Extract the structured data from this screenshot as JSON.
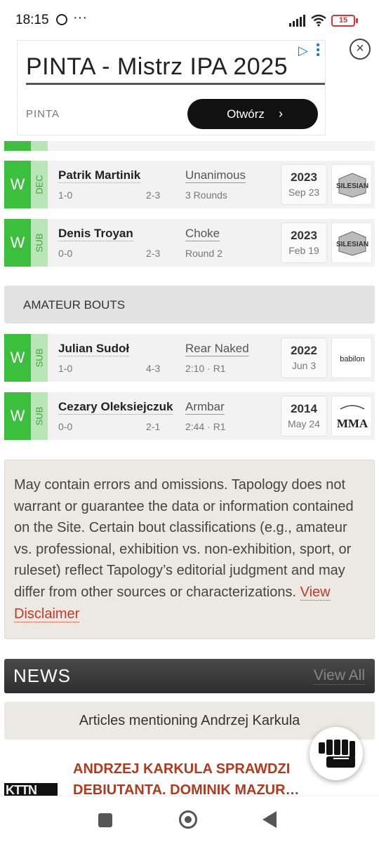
{
  "status_bar": {
    "time": "18:15",
    "dots": "···",
    "battery": "15"
  },
  "ad": {
    "title": "PINTA - Mistrz IPA 2025",
    "brand": "PINTA",
    "cta": "Otwórz",
    "close_icon": "close-icon"
  },
  "pro_bouts": [
    {
      "result": "W",
      "method": "DEC",
      "opponent": "Patrik Martinik",
      "opponent_record_before": "1-0",
      "opponent_record_after": "2-3",
      "detail": "Unanimous",
      "detail2": "3 Rounds",
      "year": "2023",
      "date": "Sep 23",
      "logo": "SILESIAN"
    },
    {
      "result": "W",
      "method": "SUB",
      "opponent": "Denis Troyan",
      "opponent_record_before": "0-0",
      "opponent_record_after": "2-3",
      "detail": "Choke",
      "detail2": "Round 2",
      "year": "2023",
      "date": "Feb 19",
      "logo": "SILESIAN"
    }
  ],
  "amateur_header": "AMATEUR BOUTS",
  "amateur_bouts": [
    {
      "result": "W",
      "method": "SUB",
      "opponent": "Julian Sudoł",
      "opponent_record_before": "1-0",
      "opponent_record_after": "4-3",
      "detail": "Rear Naked",
      "detail2": "2:10 · R1",
      "year": "2022",
      "date": "Jun 3",
      "logo": "babilon"
    },
    {
      "result": "W",
      "method": "SUB",
      "opponent": "Cezary Oleksiejczuk",
      "opponent_record_before": "0-0",
      "opponent_record_after": "2-1",
      "detail": "Armbar",
      "detail2": "2:44 · R1",
      "year": "2014",
      "date": "May 24",
      "logo": "MMA"
    }
  ],
  "disclaimer": {
    "text": "May contain errors and omissions. Tapology does not warrant or guarantee the data or information contained on the Site. Certain bout classifications (e.g., amateur vs. professional, exhibition vs. non-exhibition, sport, or ruleset) reflect Tapology’s editorial judgment and may differ from other sources or characterizations.",
    "link": "View Disclaimer"
  },
  "news": {
    "title": "NEWS",
    "view_all": "View All",
    "articles_label": "Articles mentioning Andrzej Karkula",
    "article_title_line1": "ANDRZEJ KARKULA SPRAWDZI",
    "article_title_line2": "DEBIUTANTA. DOMINIK MAZUR…",
    "thumb_text": "KTTN"
  }
}
